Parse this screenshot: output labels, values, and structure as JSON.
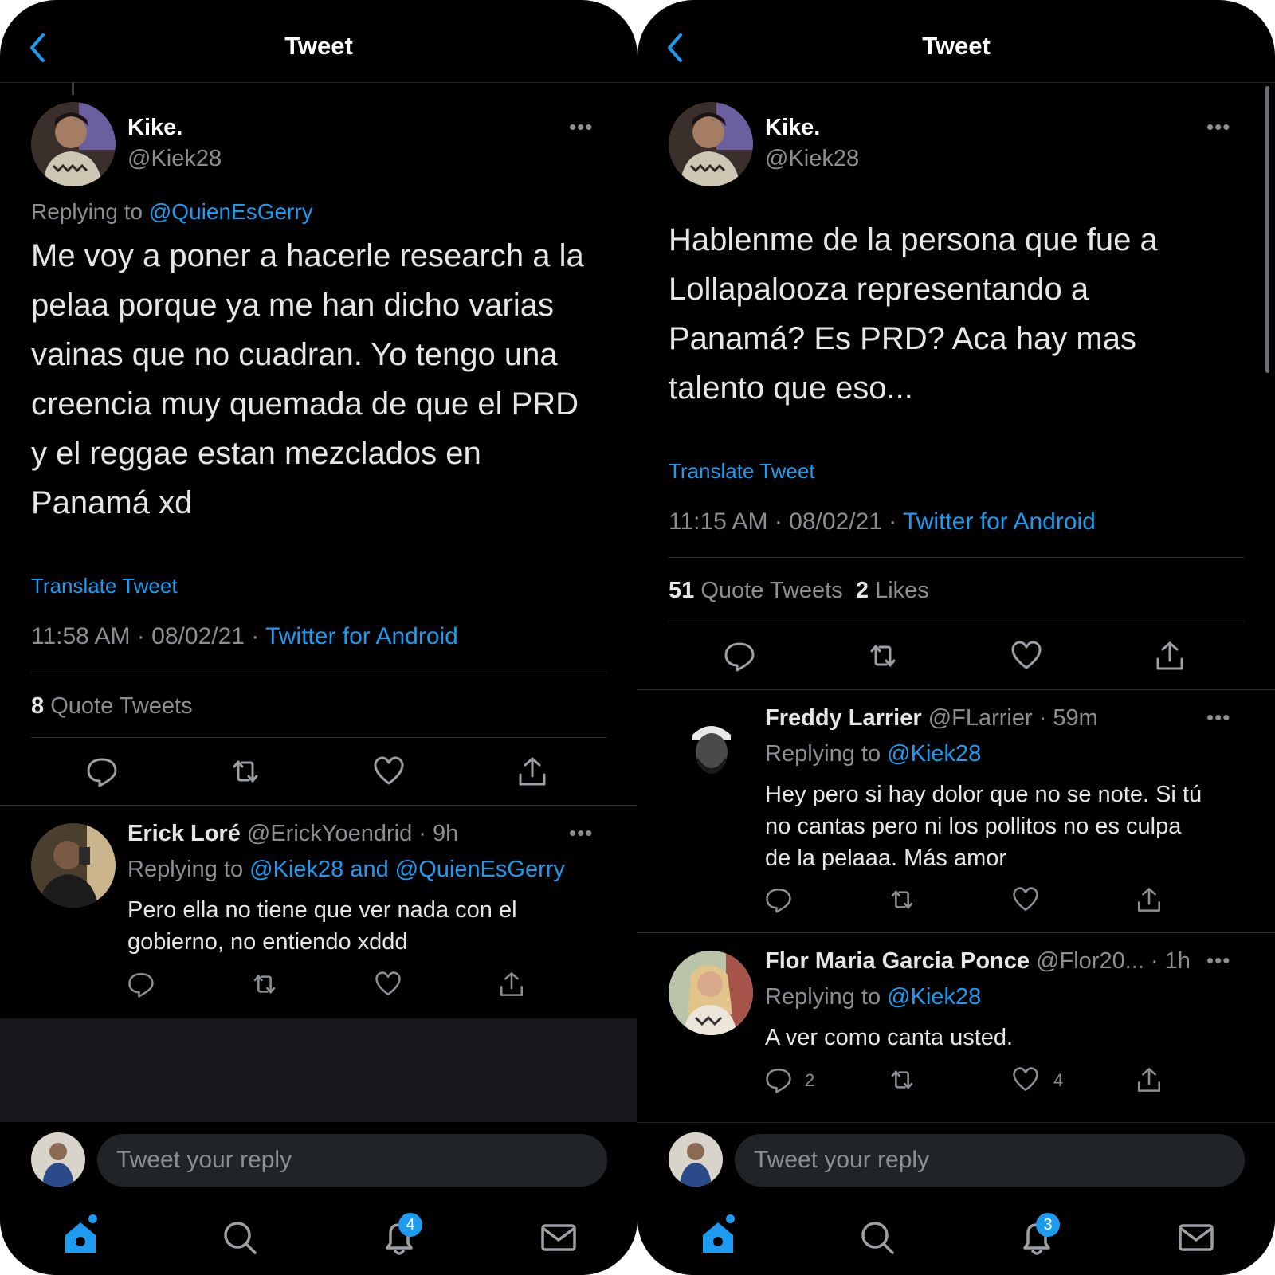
{
  "colors": {
    "background": "#000000",
    "accent": "#1d9bf0",
    "text": "#e6e6e6",
    "muted": "#8b8f94"
  },
  "left": {
    "header": {
      "title": "Tweet"
    },
    "tweet": {
      "name": "Kike.",
      "handle": "@Kiek28",
      "replying_prefix": "Replying to ",
      "replying_to": "@QuienEsGerry",
      "lines": [
        "Me voy a poner a hacerle research a la",
        "pelaa porque ya me han dicho varias",
        "vainas que no cuadran. Yo tengo una",
        "creencia muy quemada de que el PRD",
        "y el reggae estan mezclados en",
        "Panamá xd"
      ],
      "translate": "Translate Tweet",
      "timestamp": "11:58 AM · 08/02/21 · ",
      "source": "Twitter for Android",
      "quote_count": "8",
      "quote_label": "Quote Tweets"
    },
    "replies": [
      {
        "name": "Erick Loré",
        "meta": " @ErickYoendrid · 9h",
        "replying_prefix": "Replying to ",
        "replying_to": "@Kiek28 and @QuienEsGerry",
        "lines": [
          "Pero ella no tiene que ver nada con el",
          "gobierno, no entiendo xddd"
        ]
      }
    ],
    "composer": {
      "placeholder": "Tweet your reply"
    },
    "tabbar": {
      "notifications_badge": "4",
      "icons": [
        "home-icon",
        "search-icon",
        "bell-icon",
        "mail-icon"
      ]
    }
  },
  "right": {
    "header": {
      "title": "Tweet"
    },
    "tweet": {
      "name": "Kike.",
      "handle": "@Kiek28",
      "lines": [
        "Hablenme de la persona que fue a",
        "Lollapalooza representando a",
        "Panamá? Es PRD? Aca hay mas",
        "talento que eso..."
      ],
      "translate": "Translate Tweet",
      "timestamp": "11:15 AM · 08/02/21 · ",
      "source": "Twitter for Android",
      "quote_count": "51",
      "quote_label": "Quote Tweets",
      "likes_count": "2",
      "likes_label": "Likes"
    },
    "replies": [
      {
        "name": "Freddy Larrier",
        "meta": " @FLarrier · 59m",
        "replying_prefix": "Replying to ",
        "replying_to": "@Kiek28",
        "lines": [
          "Hey pero si hay dolor que no se note. Si tú",
          "no cantas pero ni los pollitos no es culpa",
          "de la pelaaa. Más amor"
        ]
      },
      {
        "name": "Flor Maria Garcia Ponce",
        "meta": " @Flor20... · 1h",
        "replying_prefix": "Replying to ",
        "replying_to": "@Kiek28",
        "lines": [
          "A ver como canta usted."
        ],
        "reply_count": "2",
        "like_count": "4"
      }
    ],
    "composer": {
      "placeholder": "Tweet your reply"
    },
    "tabbar": {
      "notifications_badge": "3",
      "icons": [
        "home-icon",
        "search-icon",
        "bell-icon",
        "mail-icon"
      ]
    }
  }
}
